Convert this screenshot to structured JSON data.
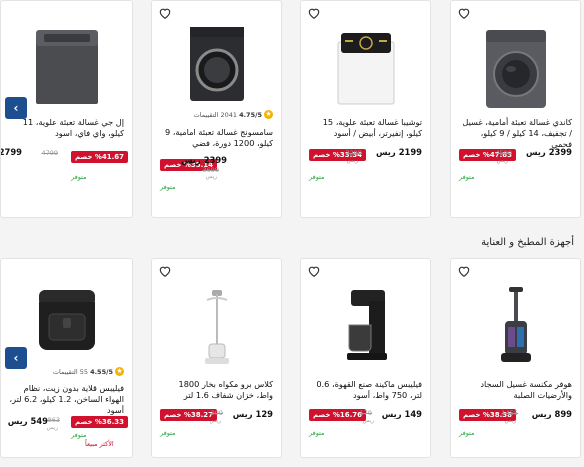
{
  "sections": [
    {
      "title": "",
      "products": [
        {
          "title": "كاندي غسالة تعبئة أمامية، غسيل / تجفيف، 14 كيلو / 9 كيلو، فحمي",
          "price": "2399 ريس",
          "old_price": "4500",
          "old_currency": "ريس",
          "discount": "%47.83 خصم",
          "availability": "متوفر",
          "image": "front-load-washer-dark"
        },
        {
          "title": "توشيبا غسالة تعبئة علوية، 15 كيلو، إنفيرتر، أبيض / أسود",
          "price": "2199 ريس",
          "old_price": "3299",
          "old_currency": "ريس",
          "discount": "%33.34 خصم",
          "availability": "متوفر",
          "image": "top-load-washer-white"
        },
        {
          "rating": "4.75/5",
          "reviews": "2041 التقييمات",
          "title": "سامسونج غسالة تعبئة امامية، 9 كيلو، 1200 دورة، فضي",
          "price": "2399 ريس",
          "old_price": "3699",
          "old_currency": "ريس",
          "discount": "%35.14 خصم",
          "availability": "متوفر",
          "image": "front-load-washer-black"
        },
        {
          "title": "إل جي غسالة تعبئة علوية، 11 كيلو، واي فاي، اسود",
          "price": "2799",
          "old_price": "4799",
          "old_currency": "",
          "discount": "%41.67 خصم",
          "availability": "متوفر",
          "image": "top-load-washer-gray"
        }
      ]
    },
    {
      "title": "أجهزة المطبخ و العناية",
      "products": [
        {
          "title": "هوفر مكنسة غسيل السجاد والأرضيات الصلبة",
          "price": "899 ريس",
          "old_price": "1455",
          "old_currency": "ريس",
          "discount": "%38.38 خصم",
          "availability": "متوفر",
          "image": "carpet-washer"
        },
        {
          "title": "فيليبس ماكينة صنع القهوة، 0.6 لتر، 750 واط، أسود",
          "price": "149 ريس",
          "old_price": "179",
          "old_currency": "ريس",
          "discount": "%16.76 خصم",
          "availability": "متوفر",
          "image": "coffee-maker"
        },
        {
          "title": "كلاس برو مكواه بخار 1800 واط، خزان شفاف 1.6 لتر",
          "price": "129 ريس",
          "old_price": "209",
          "old_currency": "ريس",
          "discount": "%38.27 خصم",
          "availability": "متوفر",
          "image": "garment-steamer"
        },
        {
          "rating": "4.55/5",
          "reviews": "55 التقييمات",
          "title": "فيليبس قلاية بدون زيت، نظام الهواء الساخن، 1.2 كيلو، 6.2 لتر، أسود",
          "price": "549 ريس",
          "old_price": "863",
          "old_currency": "ريس",
          "discount": "%36.33 خصم",
          "availability": "متوفر",
          "best_seller": "الأكثر مبيعاً",
          "image": "air-fryer"
        }
      ]
    }
  ],
  "nav": {
    "prev_symbol": "‹"
  },
  "colors": {
    "badge": "#d1122e",
    "in_stock": "#26a541",
    "arrow": "#1d4e8f",
    "star": "#f5b301"
  }
}
